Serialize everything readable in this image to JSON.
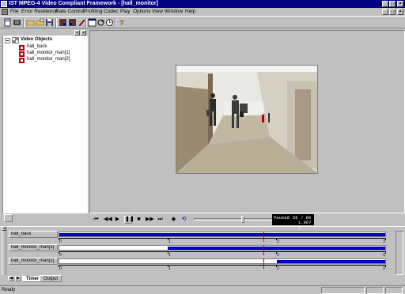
{
  "window": {
    "title": "IST MPEG-4 Video Compliant Framework - [hall_monitor]"
  },
  "menu": [
    {
      "label": "File"
    },
    {
      "label": "Error Resilience"
    },
    {
      "label": "Rate Control"
    },
    {
      "label": "Profiling"
    },
    {
      "label": "Codec"
    },
    {
      "label": "Play"
    },
    {
      "label": "Options"
    },
    {
      "label": "View"
    },
    {
      "label": "Window"
    },
    {
      "label": "Help"
    }
  ],
  "tree": {
    "root": "Video Objects",
    "items": [
      "hall_back",
      "hall_monitor_man[1]",
      "hall_monitor_man[2]"
    ]
  },
  "player": {
    "status": "Paused",
    "frame": "56 /  89",
    "time": "1.867 s",
    "progress": 0.63
  },
  "timeline": {
    "ticks": [
      "0",
      "1",
      "2",
      "3"
    ],
    "cursor_fraction": 0.625,
    "tracks": [
      {
        "label": "hall_back",
        "start": 0.0,
        "end": 1.0
      },
      {
        "label": "hall_monitor_man[1]",
        "start": 0.333,
        "end": 1.0
      },
      {
        "label": "hall_monitor_man[2]",
        "start": 0.667,
        "end": 1.0
      }
    ]
  },
  "tabs": [
    "Timer",
    "Output"
  ],
  "statusbar": {
    "text": "Ready"
  },
  "colors": {
    "titlebar": "#000080",
    "track_fill": "#0000c8",
    "cursor": "#d00000",
    "face": "#c0c0c0"
  }
}
